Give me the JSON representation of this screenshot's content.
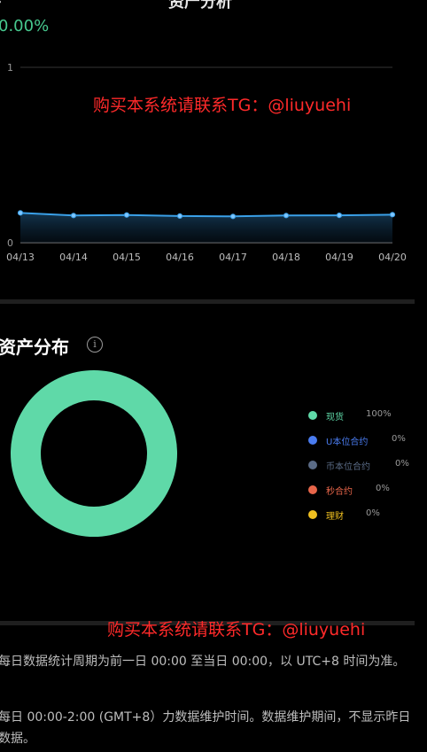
{
  "header": {
    "back_icon": "chevron-left-icon",
    "title": "资产分析"
  },
  "summary": {
    "change_percent": "0.00%"
  },
  "watermarks": [
    "购买本系统请联系TG：@liuyuehi",
    "购买本系统请联系TG：@liuyuehi"
  ],
  "chart_data": {
    "type": "area",
    "x": [
      "04/13",
      "04/14",
      "04/15",
      "04/16",
      "04/17",
      "04/18",
      "04/19",
      "04/20"
    ],
    "y_ticks": [
      "1",
      "0"
    ],
    "ylim": [
      0,
      1
    ],
    "series": [
      {
        "values": [
          0.17,
          0.155,
          0.158,
          0.152,
          0.15,
          0.155,
          0.156,
          0.16
        ]
      }
    ],
    "line_color": "#3aa0e8"
  },
  "distribution": {
    "title": "资产分布",
    "info_icon": "info-icon",
    "donut": {
      "values": [
        100,
        0,
        0,
        0,
        0
      ]
    },
    "legend": [
      {
        "label": "现货",
        "value": "100%",
        "color": "#5fd9a8"
      },
      {
        "label": "U本位合约",
        "value": "0%",
        "color": "#4a7cf0"
      },
      {
        "label": "币本位合约",
        "value": "0%",
        "color": "#5a6b86"
      },
      {
        "label": "秒合约",
        "value": "0%",
        "color": "#e8664a"
      },
      {
        "label": "理财",
        "value": "0%",
        "color": "#f0c020"
      }
    ]
  },
  "notes": [
    "每日数据统计周期为前一日 00:00 至当日 00:00，以 UTC+8 时间为准。",
    "每日 00:00-2:00 (GMT+8）力数据维护时间。数据维护期间，不显示昨日数据。"
  ]
}
